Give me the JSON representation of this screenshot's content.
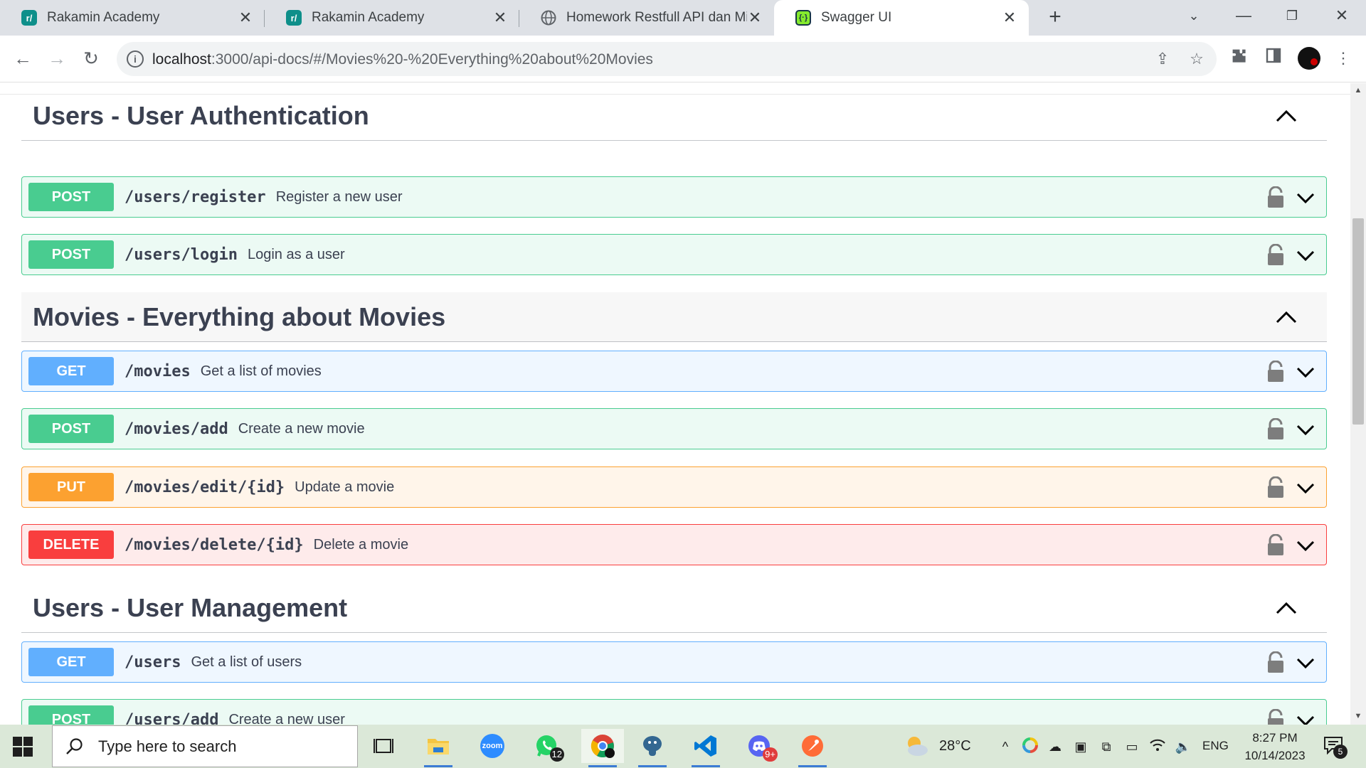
{
  "browser": {
    "tabs": [
      {
        "title": "Rakamin Academy",
        "favicon": "rakamin-icon"
      },
      {
        "title": "Rakamin Academy",
        "favicon": "rakamin-icon"
      },
      {
        "title": "Homework Restfull API dan Mid",
        "favicon": "globe-icon"
      },
      {
        "title": "Swagger UI",
        "favicon": "swagger-icon",
        "active": true
      }
    ],
    "url_host": "localhost",
    "url_path": ":3000/api-docs/#/Movies%20-%20Everything%20about%20Movies"
  },
  "sections": [
    {
      "title": "Users - User Authentication",
      "operations": [
        {
          "method": "POST",
          "path": "/users/register",
          "summary": "Register a new user"
        },
        {
          "method": "POST",
          "path": "/users/login",
          "summary": "Login as a user"
        }
      ]
    },
    {
      "title": "Movies - Everything about Movies",
      "operations": [
        {
          "method": "GET",
          "path": "/movies",
          "summary": "Get a list of movies"
        },
        {
          "method": "POST",
          "path": "/movies/add",
          "summary": "Create a new movie"
        },
        {
          "method": "PUT",
          "path": "/movies/edit/{id}",
          "summary": "Update a movie"
        },
        {
          "method": "DELETE",
          "path": "/movies/delete/{id}",
          "summary": "Delete a movie"
        }
      ]
    },
    {
      "title": "Users - User Management",
      "operations": [
        {
          "method": "GET",
          "path": "/users",
          "summary": "Get a list of users"
        },
        {
          "method": "POST",
          "path": "/users/add",
          "summary": "Create a new user"
        }
      ]
    }
  ],
  "colors": {
    "post": "#49cc90",
    "get": "#61affe",
    "put": "#fca130",
    "delete": "#f93e3e"
  },
  "taskbar": {
    "search_placeholder": "Type here to search",
    "whatsapp_badge": "12",
    "discord_badge": "9+",
    "zoom_label": "zoom",
    "temperature": "28°C",
    "language": "ENG",
    "time": "8:27 PM",
    "date": "10/14/2023",
    "notifications": "5"
  }
}
